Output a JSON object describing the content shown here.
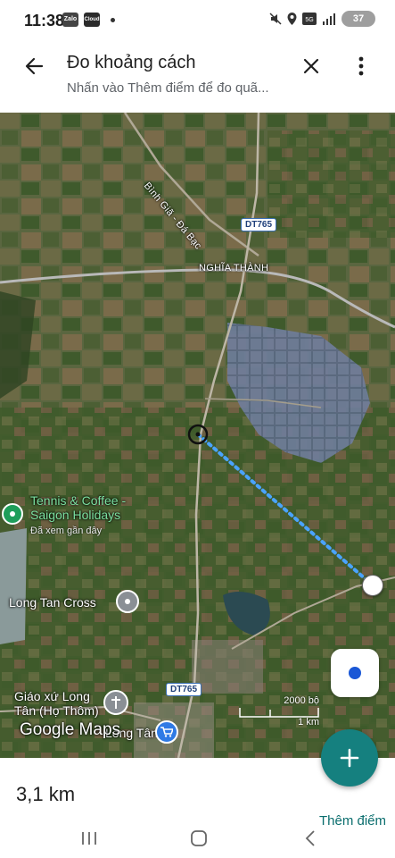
{
  "status": {
    "time": "11:38",
    "apps": [
      "Zalo",
      "Cloud"
    ],
    "battery": "37"
  },
  "header": {
    "title": "Đo khoảng cách",
    "subtitle": "Nhấn vào Thêm điểm để đo quã..."
  },
  "map": {
    "road_labels": {
      "binh_gia": "Bình Giã - Đá Bạc",
      "nghia_thanh": "NGHĨA THÀNH"
    },
    "route_shields": [
      "DT765",
      "DT765"
    ],
    "places": {
      "tennis_name": "Tennis & Coffee -\nSaigon Holidays",
      "tennis_sub": "Đã xem gần đây",
      "long_tan_cross": "Long Tan Cross",
      "giao_xu": "Giáo xứ Long\nTân (Họ Thôm)",
      "long_tan_store": "Long Tân"
    },
    "logo": "Google Maps",
    "scale": {
      "imperial": "2000 bộ",
      "metric": "1 km"
    }
  },
  "measurement": {
    "distance": "3,1 km",
    "add_point_label": "Thêm điểm"
  },
  "colors": {
    "accent": "#15807f",
    "route": "#4aa3ff",
    "link": "#0b6e6e"
  }
}
